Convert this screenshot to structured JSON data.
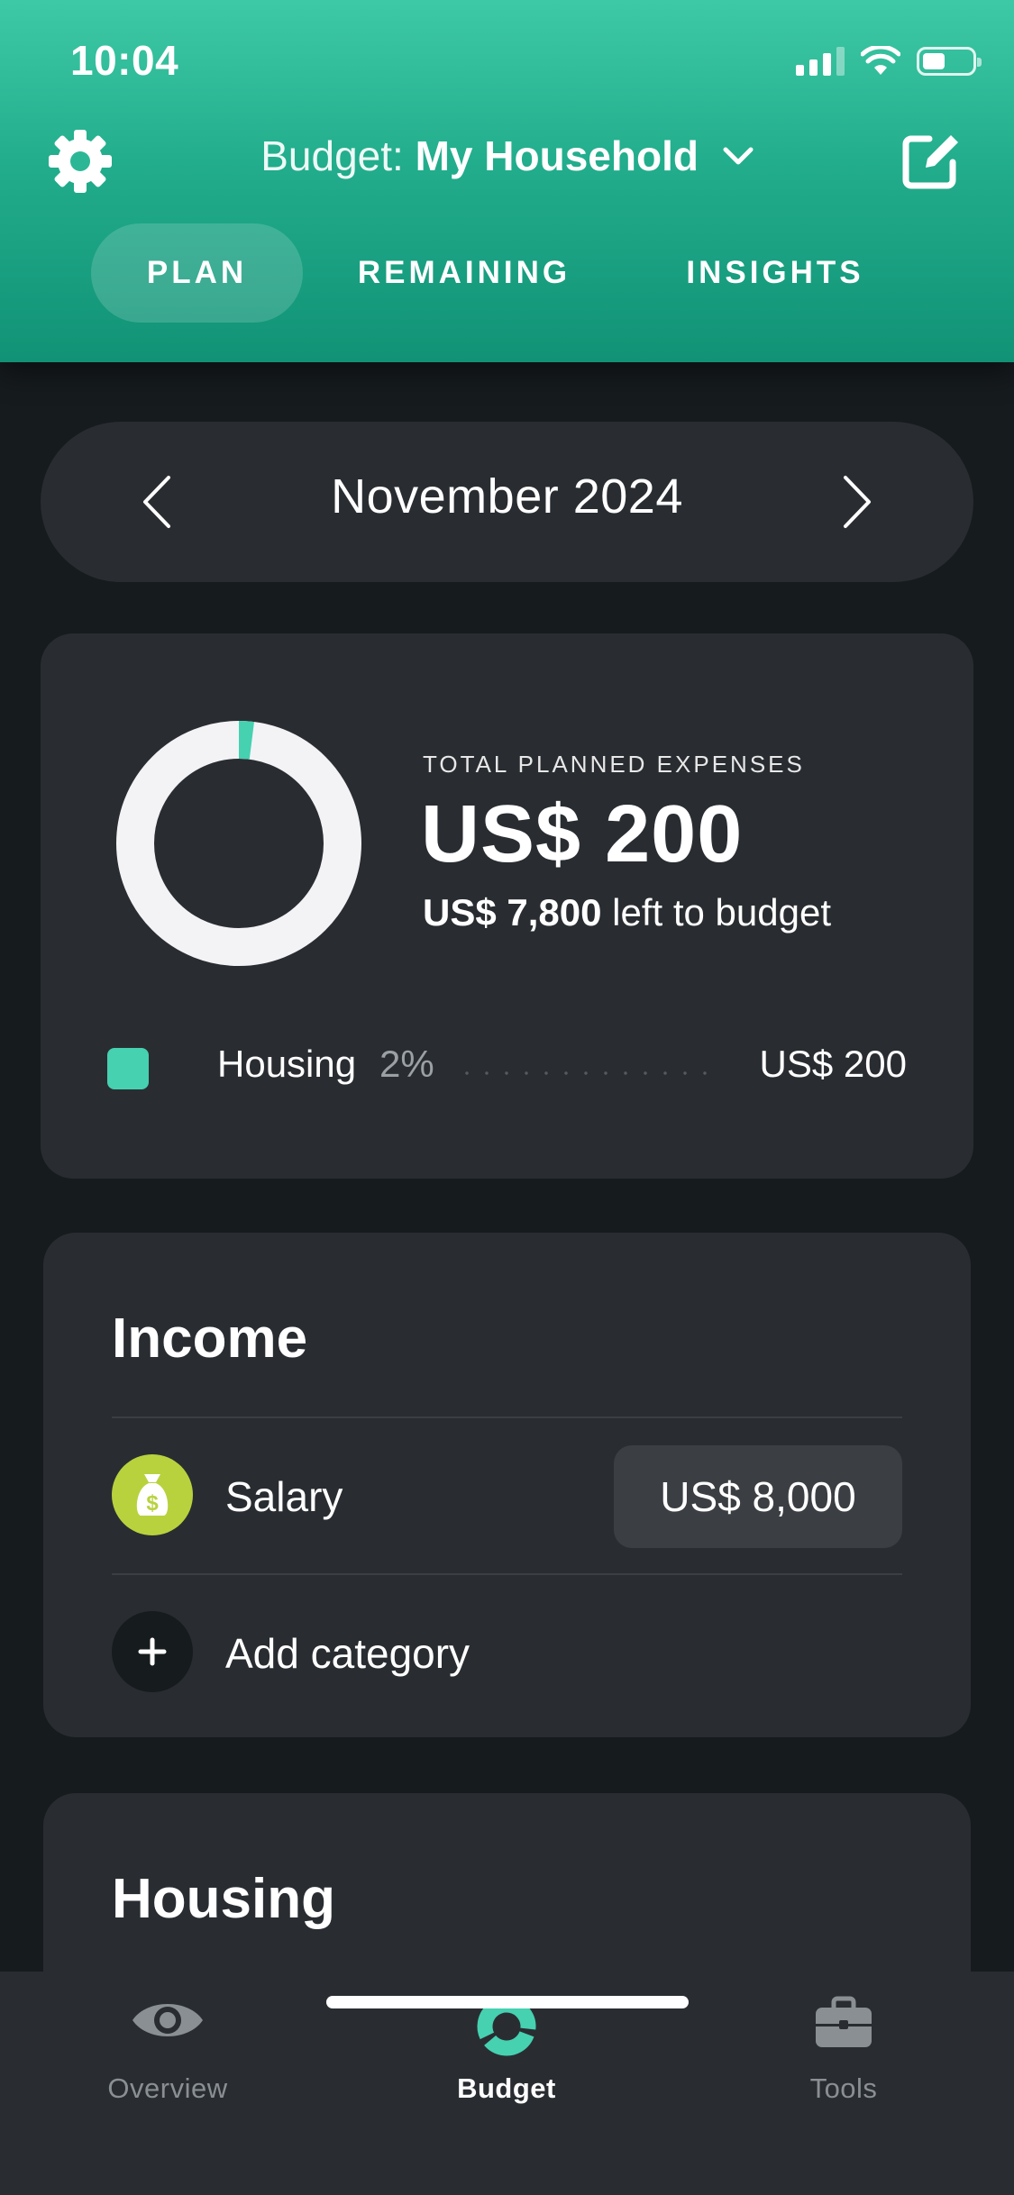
{
  "status_bar": {
    "time": "10:04"
  },
  "header": {
    "budget_prefix": "Budget:",
    "budget_name": "My Household",
    "tabs": [
      {
        "label": "PLAN",
        "active": true
      },
      {
        "label": "REMAINING",
        "active": false
      },
      {
        "label": "INSIGHTS",
        "active": false
      }
    ]
  },
  "month_nav": {
    "month": "November 2024"
  },
  "summary": {
    "label": "TOTAL PLANNED EXPENSES",
    "total": "US$ 200",
    "left_amount": "US$ 7,800",
    "left_text": "left to budget",
    "donut_fraction": 0.02,
    "legend": [
      {
        "name": "Housing",
        "percent": "2%",
        "amount": "US$ 200",
        "color": "#46d1b0"
      }
    ]
  },
  "income": {
    "title": "Income",
    "items": [
      {
        "label": "Salary",
        "amount": "US$ 8,000",
        "icon": "money-bag-icon",
        "color": "#b8d23e"
      }
    ],
    "add_label": "Add category"
  },
  "housing": {
    "title": "Housing"
  },
  "tabbar": {
    "items": [
      {
        "label": "Overview",
        "icon": "eye-icon",
        "active": false
      },
      {
        "label": "Budget",
        "icon": "budget-donut-icon",
        "active": true
      },
      {
        "label": "Tools",
        "icon": "briefcase-icon",
        "active": false
      }
    ]
  },
  "colors": {
    "accent": "#46d1b0",
    "header_gradient_start": "#3ec9a6",
    "header_gradient_end": "#119276",
    "background": "#161b1e",
    "card": "#292d31"
  }
}
